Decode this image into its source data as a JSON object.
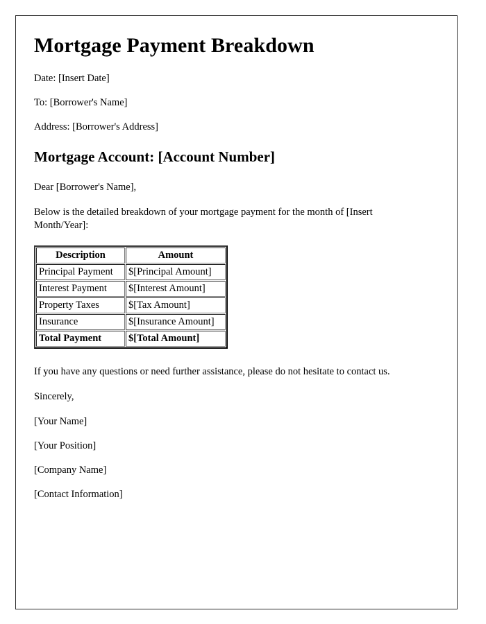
{
  "document": {
    "title": "Mortgage Payment Breakdown",
    "meta": [
      {
        "label": "date",
        "text": "Date: [Insert Date]"
      },
      {
        "label": "recipient",
        "text": "To: [Borrower's Name]"
      },
      {
        "label": "address",
        "text": "Address: [Borrower's Address]"
      }
    ],
    "account_heading": "Mortgage Account: [Account Number]",
    "salutation": "Dear [Borrower's Name],",
    "intro_paragraph": "Below is the detailed breakdown of your mortgage payment for the month of [Insert Month/Year]:",
    "closing_paragraph": "If you have any questions or need further assistance, please do not hesitate to contact us.",
    "sign_off": "Sincerely,",
    "signature": [
      {
        "label": "name",
        "text": "[Your Name]"
      },
      {
        "label": "position",
        "text": "[Your Position]"
      },
      {
        "label": "company",
        "text": "[Company Name]"
      },
      {
        "label": "contact",
        "text": "[Contact Information]"
      }
    ]
  },
  "table": {
    "headers": [
      "Description",
      "Amount"
    ],
    "rows": [
      {
        "description": "Principal Payment",
        "amount": "$[Principal Amount]",
        "emphasis": false
      },
      {
        "description": "Interest Payment",
        "amount": "$[Interest Amount]",
        "emphasis": false
      },
      {
        "description": "Property Taxes",
        "amount": "$[Tax Amount]",
        "emphasis": false
      },
      {
        "description": "Insurance",
        "amount": "$[Insurance Amount]",
        "emphasis": false
      },
      {
        "description": "Total Payment",
        "amount": "$[Total Amount]",
        "emphasis": true
      }
    ]
  }
}
